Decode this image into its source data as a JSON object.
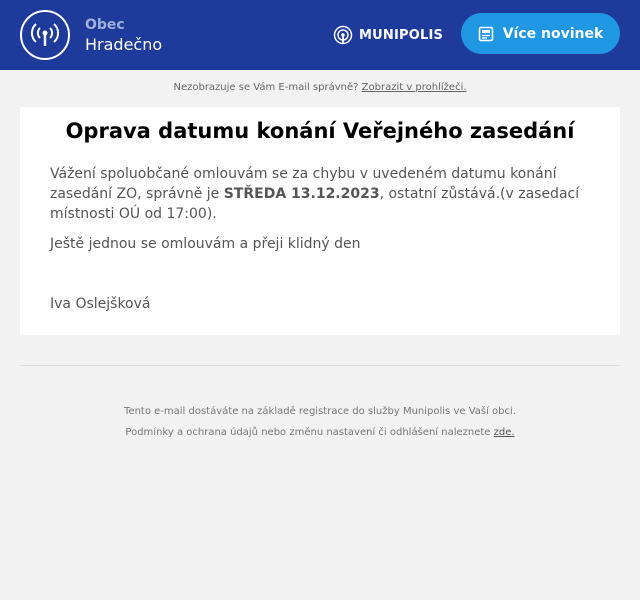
{
  "header": {
    "org_label": "Obec",
    "org_name": "Hradečno",
    "brand": "MUNIPOLIS",
    "more_button": "Více novinek",
    "logo_icon": "broadcast-icon",
    "button_icon": "newspaper-icon",
    "colors": {
      "header_bg": "#1e3a9a",
      "button_bg": "#1f97e3"
    }
  },
  "preheader": {
    "text": "Nezobrazuje se Vám E-mail správně?",
    "link": "Zobrazit v prohlížeči."
  },
  "message": {
    "title": "Oprava datumu konání Veřejného zasedání",
    "p1_start": "Vážení spoluobčané omlouvám se za chybu v uvedeném  datumu konání zasedání ZO, správně je ",
    "p1_bold": "STŘEDA 13.12.2023",
    "p1_end": ", ostatní zůstává.(v zasedací místnosti OÚ od 17:00).",
    "p2": "Ještě jednou se omlouvám a přeji klidný den",
    "signature": "Iva Oslejšková"
  },
  "footer": {
    "line1": "Tento e-mail dostáváte na základě registrace do služby Munipolis ve Vaší obci.",
    "line2_text": "Podmínky a ochrana údajů nebo změnu nastavení či odhlášení naleznete ",
    "line2_link": "zde."
  }
}
